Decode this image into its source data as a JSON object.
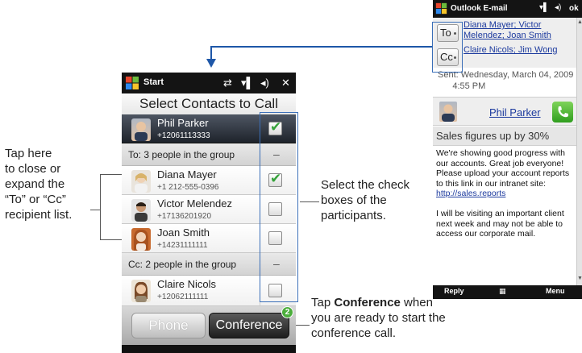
{
  "callouts": {
    "left": "Tap here\nto close or\nexpand the\n“To” or “Cc”\nrecipient list.",
    "middle": "Select the check\nboxes of the\nparticipants.",
    "bottom_prefix": "Tap ",
    "bottom_bold": "Conference",
    "bottom_suffix": " when\nyou are ready to start the\nconference call."
  },
  "contacts_screen": {
    "status_title": "Start",
    "title": "Select Contacts to Call",
    "selected_contact": {
      "name": "Phil Parker",
      "number": "+12061113333",
      "checked": true
    },
    "to_group": "To: 3 people in the group",
    "to_contacts": [
      {
        "name": "Diana Mayer",
        "number": "+1 212-555-0396",
        "checked": true
      },
      {
        "name": "Victor Melendez",
        "number": "+17136201920",
        "checked": false
      },
      {
        "name": "Joan Smith",
        "number": "+14231111111",
        "checked": false
      }
    ],
    "cc_group": "Cc: 2 people in the group",
    "cc_contacts": [
      {
        "name": "Claire Nicols",
        "number": "+12062111111",
        "checked": false
      }
    ],
    "collapse_symbol": "–",
    "phone_button": "Phone",
    "conference_button": "Conference",
    "conference_badge": "2"
  },
  "email_screen": {
    "status_title": "Outlook E-mail",
    "ok_label": "ok",
    "to_label": "To",
    "cc_label": "Cc",
    "to_recipients_line1": "Diana Mayer; Victor",
    "to_recipients_line2": "Melendez; Joan Smith",
    "cc_recipients": "Claire Nicols; Jim Wong",
    "sent": "Sent: Wednesday, March 04, 2009\n      4:55 PM",
    "sender": "Phil Parker",
    "subject": "Sales figures up by 30%",
    "body_1": "We're showing good progress with our accounts. Great job everyone! Please upload your account reports to this link in our intranet site: ",
    "body_link": "http://sales.reports",
    "body_2": "I will be visiting an important client next week and may not be able to access our corporate mail.",
    "softkey_left": "Reply",
    "softkey_right": "Menu"
  },
  "colors": {
    "accent_blue": "#1e57a8",
    "check_green": "#35a23a",
    "link_blue": "#1c3a9e"
  }
}
